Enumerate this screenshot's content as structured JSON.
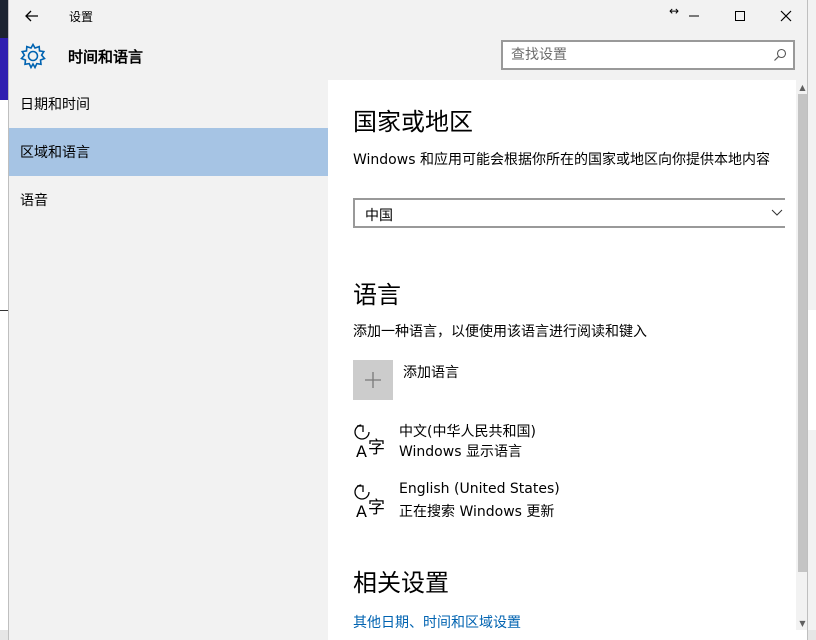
{
  "window": {
    "title": "设置",
    "header_title": "时间和语言"
  },
  "search": {
    "placeholder": "查找设置"
  },
  "sidebar": {
    "items": [
      {
        "label": "日期和时间",
        "active": false
      },
      {
        "label": "区域和语言",
        "active": true
      },
      {
        "label": "语音",
        "active": false
      }
    ]
  },
  "region": {
    "heading": "国家或地区",
    "description": "Windows 和应用可能会根据你所在的国家或地区向你提供本地内容",
    "selected": "中国"
  },
  "language": {
    "heading": "语言",
    "description": "添加一种语言，以便使用该语言进行阅读和键入",
    "add_label": "添加语言",
    "items": [
      {
        "name": "中文(中华人民共和国)",
        "status": "Windows 显示语言"
      },
      {
        "name": "English (United States)",
        "status": "正在搜索 Windows 更新"
      }
    ]
  },
  "related": {
    "heading": "相关设置",
    "link": "其他日期、时间和区域设置"
  },
  "colors": {
    "accent": "#0063b1",
    "active_nav": "#a6c4e4",
    "chrome": "#f2f2f2"
  }
}
